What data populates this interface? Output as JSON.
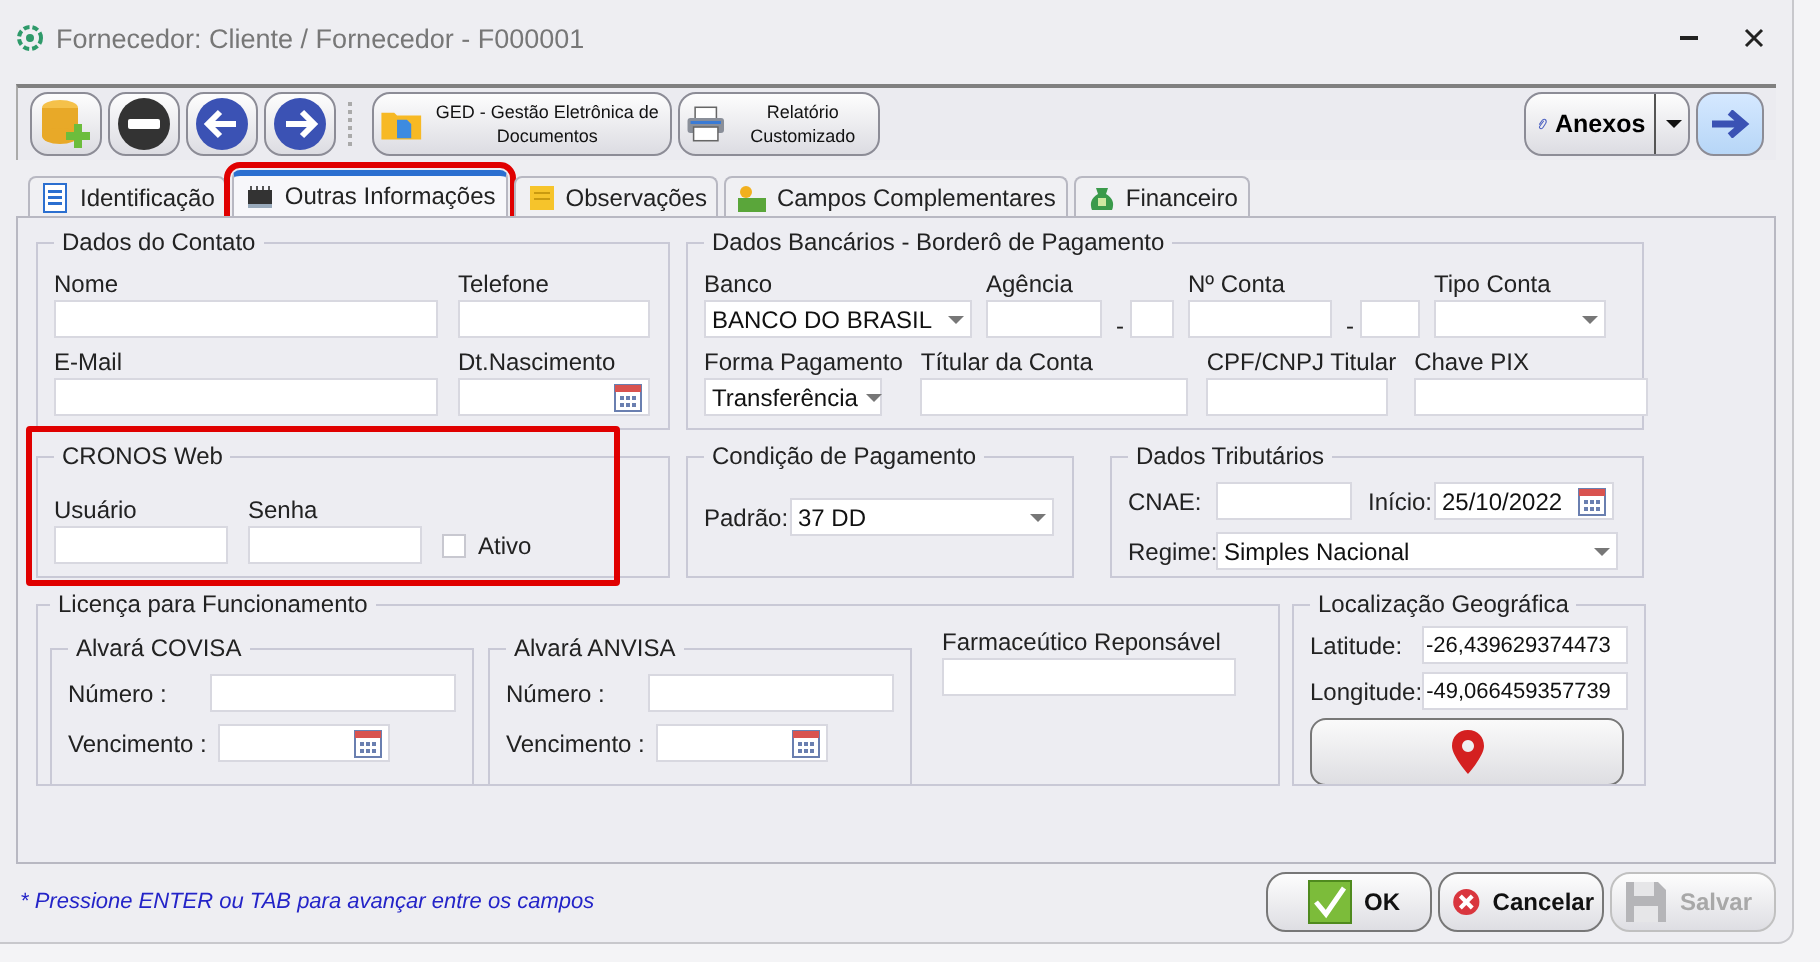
{
  "window": {
    "title": "Fornecedor: Cliente / Fornecedor - F000001"
  },
  "toolbar": {
    "buttons": [
      {
        "label": "GED - Gestão Eletrônica de Documentos"
      },
      {
        "label": "Relatório Customizado"
      }
    ],
    "attachments": {
      "label": "Anexos"
    }
  },
  "tabs": [
    {
      "label": "Identificação",
      "selected": false,
      "highlighted": false
    },
    {
      "label": "Outras Informações",
      "selected": true,
      "highlighted": true
    },
    {
      "label": "Observações",
      "selected": false,
      "highlighted": false
    },
    {
      "label": "Campos Complementares",
      "selected": false,
      "highlighted": false
    },
    {
      "label": "Financeiro",
      "selected": false,
      "highlighted": false
    }
  ],
  "contact": {
    "title": "Dados do Contato",
    "rows": [
      [
        {
          "label": "Nome",
          "kind": "text"
        },
        {
          "label": "Telefone",
          "kind": "text"
        }
      ],
      [
        {
          "label": "E-Mail",
          "kind": "text"
        },
        {
          "label": "Dt.Nascimento",
          "kind": "date"
        }
      ]
    ]
  },
  "bank": {
    "title": "Dados Bancários - Borderô de Pagamento",
    "fields": [
      {
        "label": "Banco",
        "kind": "combo",
        "value": "BANCO DO BRASIL"
      },
      {
        "label": "Agência",
        "kind": "text"
      },
      {
        "kind": "text",
        "separator": "-"
      },
      {
        "label": "Nº Conta",
        "kind": "text"
      },
      {
        "kind": "text",
        "separator": "-"
      },
      {
        "label": "Tipo Conta",
        "kind": "combo"
      },
      {
        "label": "Forma Pagamento",
        "kind": "combo",
        "value": "Transferência"
      },
      {
        "label": "Títular da Conta",
        "kind": "text"
      },
      {
        "label": "CPF/CNPJ Titular",
        "kind": "text"
      },
      {
        "label": "Chave PIX",
        "kind": "text"
      }
    ]
  },
  "cronos": {
    "title": "CRONOS Web",
    "highlighted": true,
    "fields": [
      {
        "label": "Usuário",
        "kind": "text"
      },
      {
        "label": "Senha",
        "kind": "text"
      },
      {
        "label": "Ativo",
        "kind": "checkbox",
        "checked": false
      }
    ]
  },
  "payment": {
    "title": "Condição de Pagamento",
    "fields": [
      {
        "label": "Padrão:",
        "kind": "combo",
        "value": "37 DD"
      }
    ]
  },
  "tax": {
    "title": "Dados Tributários",
    "rows": [
      [
        {
          "label": "CNAE:",
          "kind": "text"
        },
        {
          "label": "Início:",
          "kind": "date",
          "value": "25/10/2022"
        }
      ],
      [
        {
          "label": "Regime:",
          "kind": "combo",
          "value": "Simples Nacional"
        }
      ]
    ]
  },
  "license": {
    "title": "Licença para Funcionamento",
    "permits": [
      {
        "title": "Alvará COVISA",
        "fields": [
          {
            "label": "Número :",
            "kind": "text"
          },
          {
            "label": "Vencimento :",
            "kind": "date"
          }
        ]
      },
      {
        "title": "Alvará ANVISA",
        "fields": [
          {
            "label": "Número :",
            "kind": "text"
          },
          {
            "label": "Vencimento :",
            "kind": "date"
          }
        ]
      }
    ],
    "pharmacist": {
      "label": "Farmaceútico Reponsável",
      "kind": "text"
    }
  },
  "location": {
    "title": "Localização Geográfica",
    "fields": [
      {
        "label": "Latitude:",
        "kind": "text",
        "value": "-26,439629374473"
      },
      {
        "label": "Longitude:",
        "kind": "text",
        "value": "-49,066459357739"
      }
    ]
  },
  "footer": {
    "hint": "* Pressione ENTER ou TAB para avançar entre os campos",
    "buttons": [
      {
        "label": "OK",
        "disabled": false
      },
      {
        "label": "Cancelar",
        "disabled": false
      },
      {
        "label": "Salvar",
        "disabled": true
      }
    ]
  }
}
